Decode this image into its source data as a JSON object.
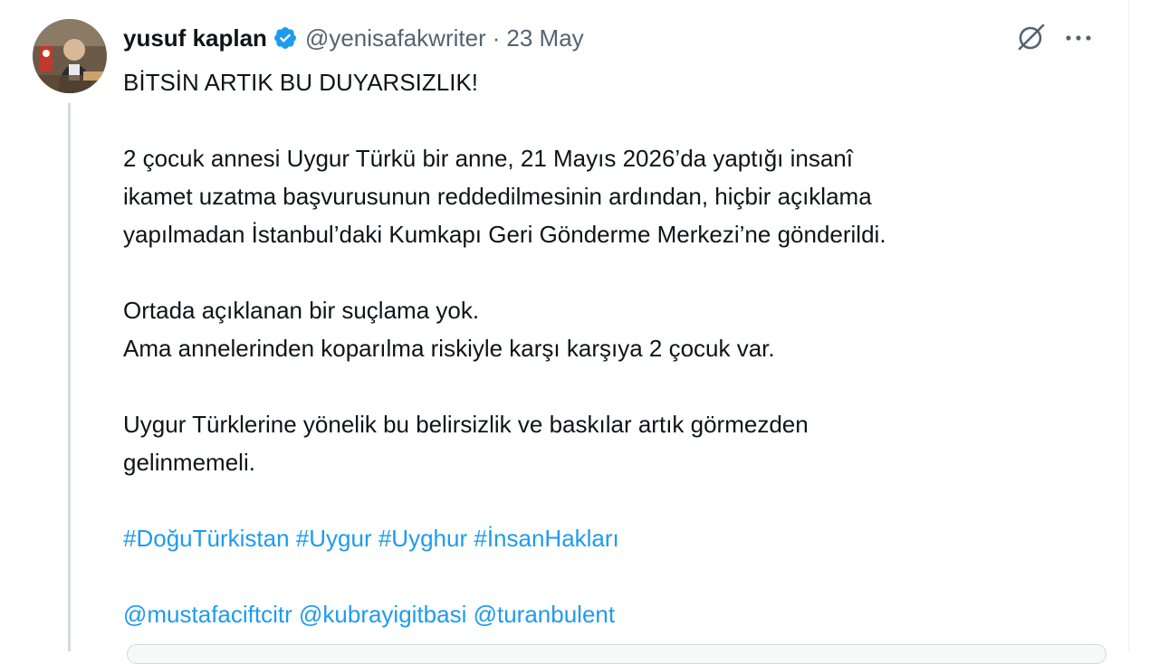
{
  "tweet": {
    "author_name": "yusuf kaplan",
    "handle": "@yenisafakwriter",
    "separator": "·",
    "date": "23 May",
    "verified_icon": "verified-badge-icon",
    "lines": {
      "title": "BİTSİN ARTIK BU DUYARSIZLIK!",
      "p1_l1": "2 çocuk annesi Uygur Türkü bir anne, 21 Mayıs 2026’da yaptığı insanî",
      "p1_l2": "ikamet uzatma başvurusunun reddedilmesinin ardından, hiçbir açıklama",
      "p1_l3": "yapılmadan İstanbul’daki Kumkapı Geri Gönderme Merkezi’ne gönderildi.",
      "p2_l1": "Ortada açıklanan bir suçlama yok.",
      "p2_l2": "Ama annelerinden koparılma riskiyle karşı karşıya 2 çocuk var.",
      "p3_l1": "Uygur Türklerine yönelik bu belirsizlik ve baskılar artık görmezden",
      "p3_l2": "gelinmemeli."
    },
    "hashtags": [
      "#DoğuTürkistan",
      "#Uygur",
      "#Uyghur",
      "#İnsanHakları"
    ],
    "mentions": [
      "@mustafaciftcitr",
      "@kubrayigitbasi",
      "@turanbulent"
    ]
  },
  "icons": {
    "grok": "grok-icon",
    "more": "more-options-icon"
  },
  "colors": {
    "text": "#0f1419",
    "secondary": "#536471",
    "link": "#1d9bf0",
    "verified": "#1d9bf0"
  }
}
